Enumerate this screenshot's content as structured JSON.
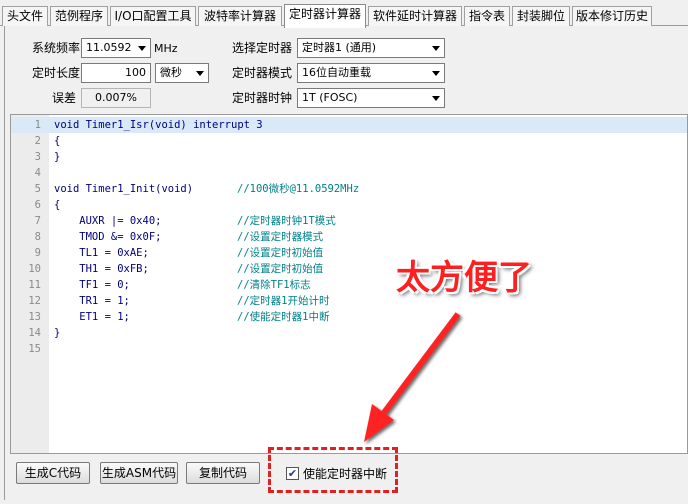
{
  "tabs": [
    {
      "label": "头文件",
      "active": false
    },
    {
      "label": "范例程序",
      "active": false
    },
    {
      "label": "I/O口配置工具",
      "active": false
    },
    {
      "label": "波特率计算器",
      "active": false
    },
    {
      "label": "定时器计算器",
      "active": true
    },
    {
      "label": "软件延时计算器",
      "active": false
    },
    {
      "label": "指令表",
      "active": false
    },
    {
      "label": "封装脚位",
      "active": false
    },
    {
      "label": "版本修订历史",
      "active": false
    }
  ],
  "form": {
    "freq_label": "系统频率",
    "freq_value": "11.0592",
    "freq_unit": "MHz",
    "length_label": "定时长度",
    "length_value": "100",
    "length_unit": "微秒",
    "error_label": "误差",
    "error_value": "0.007%",
    "timer_select_label": "选择定时器",
    "timer_select_value": "定时器1 (通用)",
    "timer_mode_label": "定时器模式",
    "timer_mode_value": "16位自动重载",
    "timer_clock_label": "定时器时钟",
    "timer_clock_value": "1T  (FOSC)"
  },
  "code_lines": [
    {
      "num": "1",
      "code": "void Timer1_Isr(void) interrupt 3",
      "comment": ""
    },
    {
      "num": "2",
      "code": "{",
      "comment": ""
    },
    {
      "num": "3",
      "code": "}",
      "comment": ""
    },
    {
      "num": "4",
      "code": "",
      "comment": ""
    },
    {
      "num": "5",
      "code": "void Timer1_Init(void)",
      "comment": "//100微秒@11.0592MHz"
    },
    {
      "num": "6",
      "code": "{",
      "comment": ""
    },
    {
      "num": "7",
      "code": "    AUXR |= 0x40;",
      "comment": "//定时器时钟1T模式"
    },
    {
      "num": "8",
      "code": "    TMOD &= 0x0F;",
      "comment": "//设置定时器模式"
    },
    {
      "num": "9",
      "code": "    TL1 = 0xAE;",
      "comment": "//设置定时初始值"
    },
    {
      "num": "10",
      "code": "    TH1 = 0xFB;",
      "comment": "//设置定时初始值"
    },
    {
      "num": "11",
      "code": "    TF1 = 0;",
      "comment": "//清除TF1标志"
    },
    {
      "num": "12",
      "code": "    TR1 = 1;",
      "comment": "//定时器1开始计时"
    },
    {
      "num": "13",
      "code": "    ET1 = 1;",
      "comment": "//使能定时器1中断"
    },
    {
      "num": "14",
      "code": "}",
      "comment": ""
    },
    {
      "num": "15",
      "code": "",
      "comment": ""
    }
  ],
  "buttons": {
    "gen_c": "生成C代码",
    "gen_asm": "生成ASM代码",
    "copy": "复制代码"
  },
  "checkbox": {
    "label": "使能定时器中断",
    "checked": true
  },
  "annotation": {
    "text": "太方便了",
    "color": "#ff1f1f"
  }
}
